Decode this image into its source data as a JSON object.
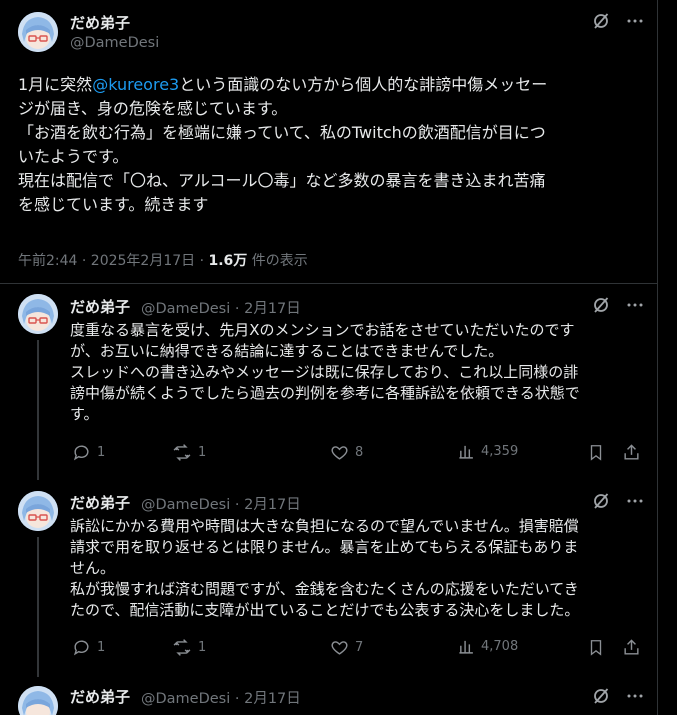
{
  "main_post": {
    "display_name": "だめ弟子",
    "handle": "@DameDesi",
    "text_before_mention": "1月に突然",
    "mention": "@kureore3",
    "text_after_mention": "という面識のない方から個人的な誹謗中傷メッセー\nジが届き、身の危険を感じています。\n「お酒を飲む行為」を極端に嫌っていて、私のTwitchの飲酒配信が目につ\nいたようです。\n現在は配信で「〇ね、アルコール〇毒」など多数の暴言を書き込まれ苦痛\nを感じています。続きます",
    "timestamp": "午前2:44 · 2025年2月17日 · ",
    "views_count": "1.6万",
    "views_label": " 件の表示"
  },
  "replies": [
    {
      "display_name": "だめ弟子",
      "handle_date": "@DameDesi · 2月17日",
      "text": "度重なる暴言を受け、先月Xのメンションでお話をさせていただいたのです\nが、お互いに納得できる結論に達することはできませんでした。\nスレッドへの書き込みやメッセージは既に保存しており、これ以上同様の誹\n謗中傷が続くようでしたら過去の判例を参考に各種訴訟を依頼できる状態で\nす。",
      "replies_count": "1",
      "reposts_count": "1",
      "likes_count": "8",
      "views_count": "4,359"
    },
    {
      "display_name": "だめ弟子",
      "handle_date": "@DameDesi · 2月17日",
      "text": "訴訟にかかる費用や時間は大きな負担になるので望んでいません。損害賠償\n請求で用を取り返せるとは限りません。暴言を止めてもらえる保証もありま\nせん。\n私が我慢すれば済む問題ですが、金銭を含むたくさんの応援をいただいてき\nたので、配信活動に支障が出ていることだけでも公表する決心をしました。",
      "replies_count": "1",
      "reposts_count": "1",
      "likes_count": "7",
      "views_count": "4,708"
    },
    {
      "display_name": "だめ弟子",
      "handle_date": "@DameDesi · 2月17日"
    }
  ],
  "colors": {
    "background": "#000000",
    "text": "#e7e9ea",
    "secondary": "#71767b",
    "accent": "#1d9bf0",
    "border": "#2f3336"
  },
  "icons": {
    "grok": "grok-icon",
    "more": "more-icon",
    "reply": "reply-icon",
    "repost": "repost-icon",
    "like": "like-icon",
    "views": "views-icon",
    "bookmark": "bookmark-icon",
    "share": "share-icon"
  }
}
